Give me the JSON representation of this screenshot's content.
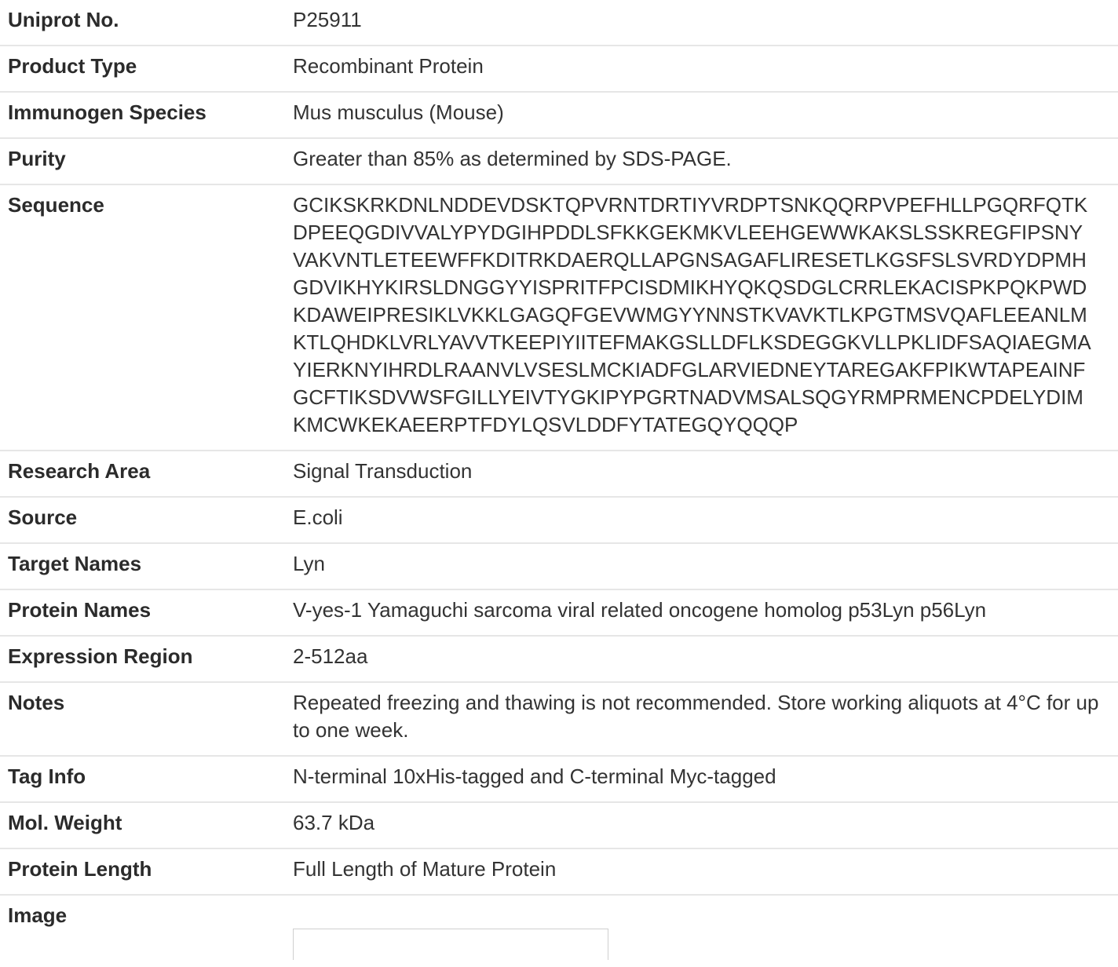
{
  "rows": [
    {
      "label": "Uniprot No.",
      "value": "P25911"
    },
    {
      "label": "Product Type",
      "value": "Recombinant Protein"
    },
    {
      "label": "Immunogen Species",
      "value": "Mus musculus (Mouse)"
    },
    {
      "label": "Purity",
      "value": "Greater than 85% as determined by SDS-PAGE."
    },
    {
      "label": "Sequence",
      "value": "GCIKSKRKDNLNDDEVDSKTQPVRNTDRTIYVRDPTSNKQQRPVPEFHLLPGQRFQTKDPEEQGDIVVALYPYDGIHPDDLSFKKGEKMKVLEEHGEWWKAKSLSSKREGFIPSNYVAKVNTLETEEWFFKDITRKDAERQLLAPGNSAGAFLIRESETLKGSFSLSVRDYDPMHGDVIKHYKIRSLDNGGYYISPRITFPCISDMIKHYQKQSDGLCRRLEKACISPKPQKPWDKDAWEIPRESIKLVKKLGAGQFGEVWMGYYNNSTKVAVKTLKPGTMSVQAFLEEANLMKTLQHDKLVRLYAVVTKEEPIYIITEFMAKGSLLDFLKSDEGGKVLLPKLIDFSAQIAEGMAYIERKNYIHRDLRAANVLVSESLMCKIADFGLARVIEDNEYTAREGAKFPIKWTAPEAINFGCFTIKSDVWSFGILLYEIVTYGKIPYPGRTNADVMSALSQGYRMPRMENCPDELYDIMKMCWKEKAEERPTFDYLQSVLDDFYTATEGQYQQQP"
    },
    {
      "label": "Research Area",
      "value": "Signal Transduction"
    },
    {
      "label": "Source",
      "value": "E.coli"
    },
    {
      "label": "Target Names",
      "value": "Lyn"
    },
    {
      "label": "Protein Names",
      "value": "V-yes-1 Yamaguchi sarcoma viral related oncogene homolog p53Lyn p56Lyn"
    },
    {
      "label": "Expression Region",
      "value": "2-512aa"
    },
    {
      "label": "Notes",
      "value": "Repeated freezing and thawing is not recommended. Store working aliquots at 4°C for up to one week."
    },
    {
      "label": "Tag Info",
      "value": "N-terminal 10xHis-tagged and C-terminal Myc-tagged"
    },
    {
      "label": "Mol. Weight",
      "value": "63.7 kDa"
    },
    {
      "label": "Protein Length",
      "value": "Full Length of Mature Protein"
    },
    {
      "label": "Image",
      "value": ""
    }
  ]
}
